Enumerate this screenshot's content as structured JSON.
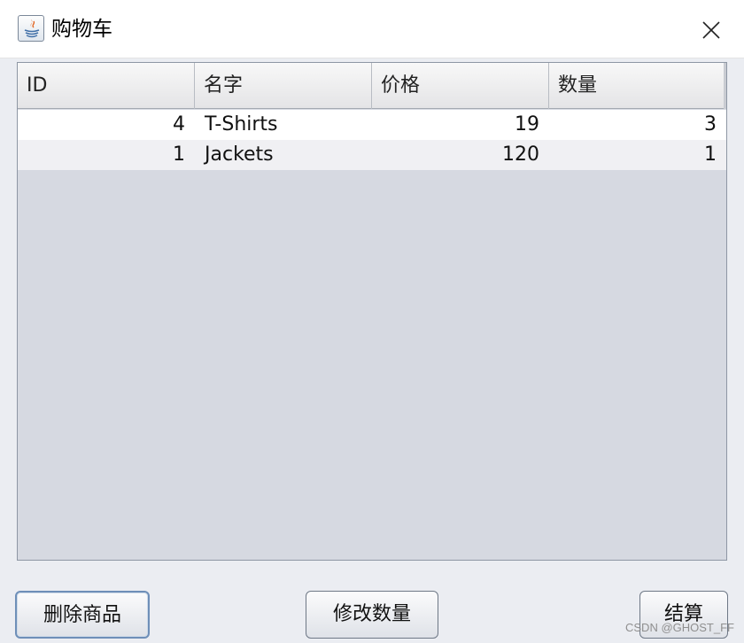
{
  "window": {
    "title": "购物车",
    "close_label": "×"
  },
  "table": {
    "columns": [
      "ID",
      "名字",
      "价格",
      "数量"
    ],
    "rows": [
      {
        "id": "4",
        "name": "T-Shirts",
        "price": "19",
        "quantity": "3"
      },
      {
        "id": "1",
        "name": "Jackets",
        "price": "120",
        "quantity": "1"
      }
    ]
  },
  "buttons": {
    "delete": "删除商品",
    "modify": "修改数量",
    "checkout": "结算"
  },
  "watermark": "CSDN @GHOST_FF",
  "colors": {
    "table_background": "#d6d9e1",
    "focus_border": "#6e8fb8"
  }
}
